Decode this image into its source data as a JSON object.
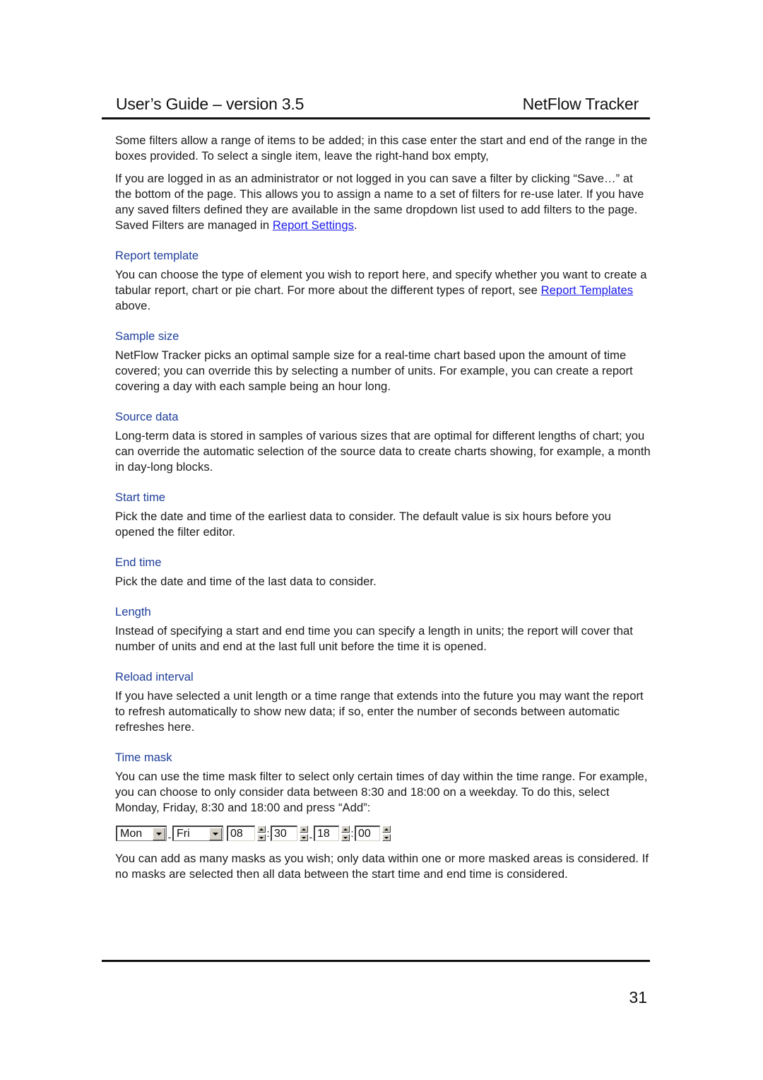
{
  "header": {
    "left": "User’s Guide – version 3.5",
    "right": "NetFlow Tracker"
  },
  "intro": {
    "p1": "Some filters allow a range of items to be added; in this case enter the start and end of the range in the boxes provided. To select a single item, leave the right-hand box empty,",
    "p2_before": "If you are logged in as an administrator or not logged in you can save a filter by clicking “Save…” at the bottom of the page. This allows you to assign a name to a set of filters for re-use later. If you have any saved filters defined they are available in the same dropdown list used to add filters to the page. Saved Filters are managed in ",
    "p2_link": "Report Settings",
    "p2_after": "."
  },
  "sections": [
    {
      "heading": "Report template",
      "text_before": "You can choose the type of element you wish to report here, and specify whether you want to create a tabular report, chart or pie chart. For more about the different types of report, see ",
      "link": "Report Templates",
      "text_after": " above."
    },
    {
      "heading": "Sample size",
      "text": "NetFlow Tracker picks an optimal sample size for a real-time chart based upon the amount of time covered; you can override this by selecting a number of units. For example, you can create a report covering a day with each sample being an hour long."
    },
    {
      "heading": "Source data",
      "text": "Long-term data is stored in samples of various sizes that are optimal for different lengths of chart; you can override the automatic selection of the source data to create charts showing, for example, a month in day-long blocks."
    },
    {
      "heading": "Start time",
      "text": "Pick the date and time of the earliest data to consider. The default value is six hours before you opened the filter editor."
    },
    {
      "heading": "End time",
      "text": "Pick the date and time of the last data to consider."
    },
    {
      "heading": "Length",
      "text": "Instead of specifying a start and end time you can specify a length in units; the report will cover that number of units and end at the last full unit before the time it is opened."
    },
    {
      "heading": "Reload interval",
      "text": "If you have selected a unit length or a time range that extends into the future you may want the report to refresh automatically to show new data; if so, enter the number of seconds between automatic refreshes here."
    },
    {
      "heading": "Time mask",
      "text": "You can use the time mask filter to select only certain times of day within the time range. For example, you can choose to only consider data between 8:30 and 18:00 on a weekday. To do this, select Monday, Friday, 8:30 and 18:00 and press “Add”:",
      "after_widget": "You can add as many masks as you wish; only data within one or more masked areas is considered. If no masks are selected then all data between the start time and end time is considered."
    }
  ],
  "time_mask_widget": {
    "start_day": "Mon",
    "end_day": "Fri",
    "range_separator": "-",
    "time_separator": ":",
    "start_hour": "08",
    "start_minute": "30",
    "end_hour": "18",
    "end_minute": "00"
  },
  "footer": {
    "page_number": "31"
  }
}
